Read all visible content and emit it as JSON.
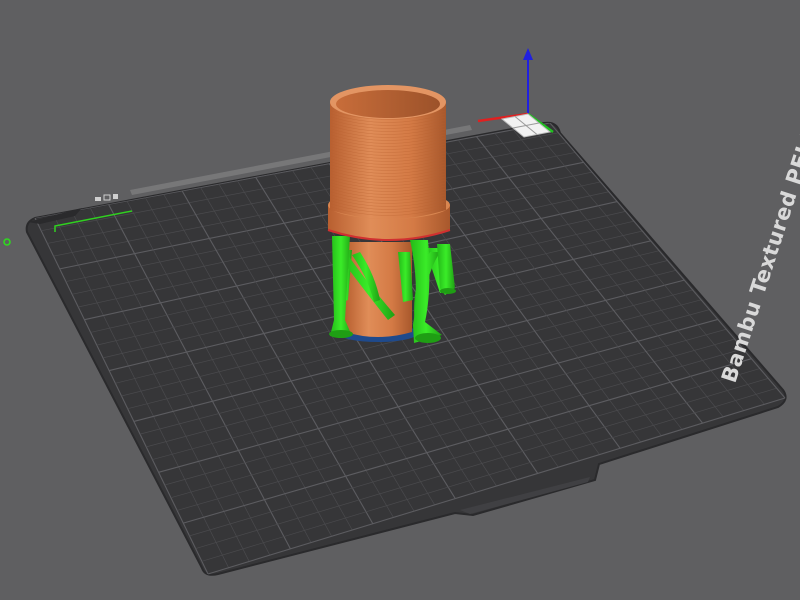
{
  "bed": {
    "label": "Bambu Textured PEI Plate"
  },
  "colors": {
    "background": "#5f5f61",
    "bed_surface": "#363638",
    "bed_edge": "#2a2a2c",
    "grid_line": "#505053",
    "grid_line_major": "#5c5c60",
    "model_orange": "#d47a45",
    "model_orange_dark": "#9c522a",
    "support_green": "#2fd81f",
    "support_green_dark": "#1f9e14",
    "first_layer_blue": "#1f4a8c",
    "axis_x_red": "#e02020",
    "axis_y_green": "#20c020",
    "axis_z_blue": "#2020e0"
  },
  "viewport": {
    "plate_selector_icon": "plate-grid-icon",
    "origin_marker_icon": "origin-ring-icon"
  }
}
